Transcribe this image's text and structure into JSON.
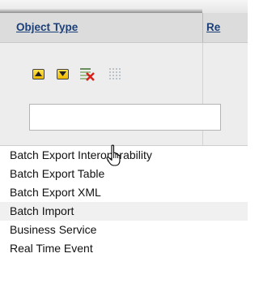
{
  "header": {
    "col1_label": "Object Type",
    "col2_label": "Re"
  },
  "toolbar": {
    "up_icon": "move-up-icon",
    "down_icon": "move-down-icon",
    "clear_icon": "clear-filter-icon",
    "grid_icon": "grid-icon",
    "accent": "#f5c400"
  },
  "filter": {
    "value": "",
    "placeholder": ""
  },
  "list": {
    "items": [
      "Batch Export Interoperability",
      "Batch Export Table",
      "Batch Export XML",
      "Batch Import",
      "Business Service",
      "Real Time Event"
    ],
    "hovered_index": 3
  },
  "cursor": {
    "icon": "hand-pointer-icon"
  }
}
